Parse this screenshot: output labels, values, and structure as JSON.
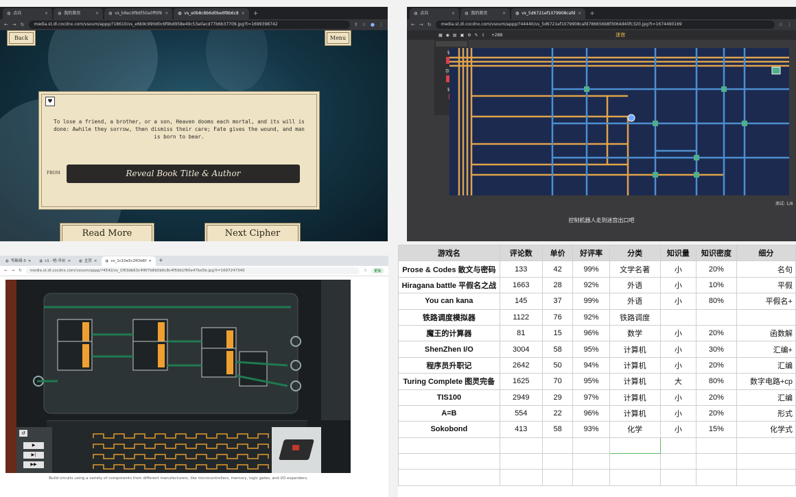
{
  "q1": {
    "tabs": [
      {
        "label": "点兵",
        "active": false
      },
      {
        "label": "我的首页",
        "active": false
      },
      {
        "label": "vs_b9ec9fb6f50a0ff0f6",
        "active": false
      },
      {
        "label": "vs_e0b8c8b6d0be6f8b6c8",
        "active": true
      }
    ],
    "url": "media.st.dl.cocdnx.com/vsoum/appp/?18610/vs_e6b9c990d0c6f9bd958e49c53a0acd77b6b37709.jpg?t=1699398742",
    "back_label": "Back",
    "menu_label": "Menu",
    "quote": "To lose a friend, a brother, or a son, Heaven dooms each mortal, and its will is done: Awhile they sorrow, then dismiss their care; Fate gives the wound, and man is born to bear.",
    "from_label": "FROM",
    "reveal_label": "Reveal Book Title & Author",
    "read_more_label": "Read More",
    "next_label": "Next Cipher"
  },
  "q2": {
    "tabs": [
      {
        "label": "点兵",
        "active": false
      },
      {
        "label": "我的首页",
        "active": false
      },
      {
        "label": "vs_5d6721ef1079908cafd",
        "active": true
      }
    ],
    "url": "media.st.dl.cocdnx.com/vsoum/appp/?44440/vs_5d6721ef1079908cafd786656b8f3064d40fc320.jpg?t=1674490169",
    "toolbar_count": "+288",
    "title": "迷宫",
    "palette": {
      "input_label": "输入",
      "store_label": "存储器",
      "output_label": "输出"
    },
    "status_text": "测试: 1/8",
    "instruction": "控制机器人走到迷宫出口吧"
  },
  "q3": {
    "tabs": [
      {
        "label": "写新闻-3",
        "active": false
      },
      {
        "label": "c1 · 吧-平价",
        "active": false
      },
      {
        "label": "主页",
        "active": false
      },
      {
        "label": "vs_1c10e5c2ff2b6f",
        "active": true
      }
    ],
    "url": "media.st.dl.cocdnx.com/vsoum/appp/?4542/vs_1f63db63c4f6f7b8b0b6c8c4f59b1f60e47be5b.jpg?t=1697247340",
    "caption": "Build circuits using a variety of components from different manufacturers, like microcontrollers, memory, logic gates, and I/O expanders.",
    "user_label": "更新"
  },
  "sheet": {
    "columns": [
      "游戏名",
      "评论数",
      "单价",
      "好评率",
      "分类",
      "知识量",
      "知识密度",
      "细分"
    ],
    "rows": [
      [
        "Prose & Codes 散文与密码",
        "133",
        "42",
        "99%",
        "文学名著",
        "小",
        "20%",
        "名句"
      ],
      [
        "Hiragana battle 平假名之战",
        "1663",
        "28",
        "92%",
        "外语",
        "小",
        "10%",
        "平假"
      ],
      [
        "You can kana",
        "145",
        "37",
        "99%",
        "外语",
        "小",
        "80%",
        "平假名+"
      ],
      [
        "铁路调度模拟器",
        "1122",
        "76",
        "92%",
        "铁路调度",
        "",
        "",
        ""
      ],
      [
        "魔王的计算器",
        "81",
        "15",
        "96%",
        "数学",
        "小",
        "20%",
        "函数解"
      ],
      [
        "ShenZhen I/O",
        "3004",
        "58",
        "95%",
        "计算机",
        "小",
        "30%",
        "汇编+"
      ],
      [
        "程序员升职记",
        "2642",
        "50",
        "94%",
        "计算机",
        "小",
        "20%",
        "汇编"
      ],
      [
        "Turing Complete 图灵完备",
        "1625",
        "70",
        "95%",
        "计算机",
        "大",
        "80%",
        "数字电路+cp"
      ],
      [
        "TIS100",
        "2949",
        "29",
        "97%",
        "计算机",
        "小",
        "20%",
        "汇编"
      ],
      [
        "A=B",
        "554",
        "22",
        "96%",
        "计算机",
        "小",
        "20%",
        "形式"
      ],
      [
        "Sokobond",
        "413",
        "58",
        "93%",
        "化学",
        "小",
        "15%",
        "化学式"
      ]
    ],
    "empty_rows": 3
  },
  "colors": {
    "sheet_header": "#d9d9d9",
    "maze_bg": "#1c2a4f",
    "maze_orange": "#e0a34a",
    "maze_blue": "#4d8fd0",
    "parchment": "#efe3c6",
    "circuit_green": "#1f7a52"
  }
}
